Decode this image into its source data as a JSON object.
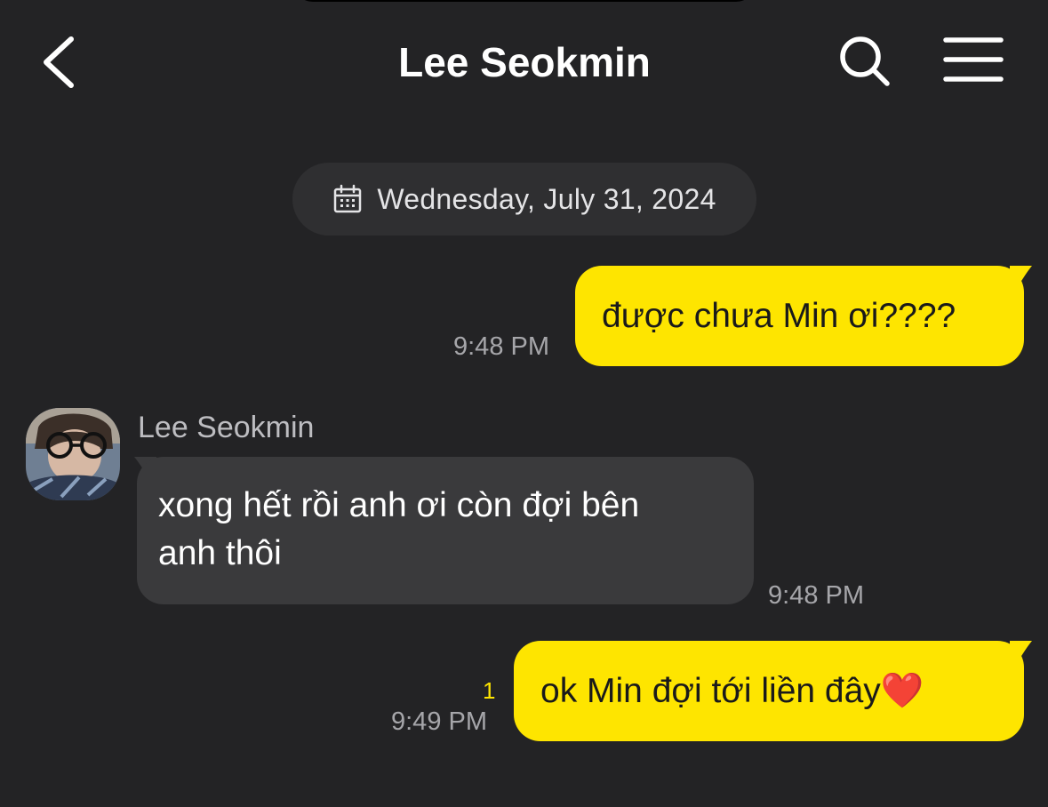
{
  "header": {
    "title": "Lee Seokmin",
    "back_icon": "chevron-left-icon",
    "search_icon": "search-icon",
    "menu_icon": "hamburger-menu-icon"
  },
  "date_divider": {
    "icon": "calendar-icon",
    "text": "Wednesday, July 31, 2024"
  },
  "messages": [
    {
      "direction": "outgoing",
      "text": "được chưa Min ơi????",
      "time": "9:48 PM"
    },
    {
      "direction": "incoming",
      "sender": "Lee Seokmin",
      "text_lines": [
        "xong hết rồi anh ơi còn đợi bên",
        "anh thôi"
      ],
      "time": "9:48 PM"
    },
    {
      "direction": "outgoing",
      "text": "ok Min đợi tới liền đây",
      "emoji": "❤️",
      "unread_count": "1",
      "time": "9:49 PM"
    }
  ],
  "colors": {
    "background": "#232325",
    "outgoing_bubble": "#fee500",
    "incoming_bubble": "#3a3a3c",
    "date_pill": "#2f2f31",
    "unread": "#fee500"
  }
}
